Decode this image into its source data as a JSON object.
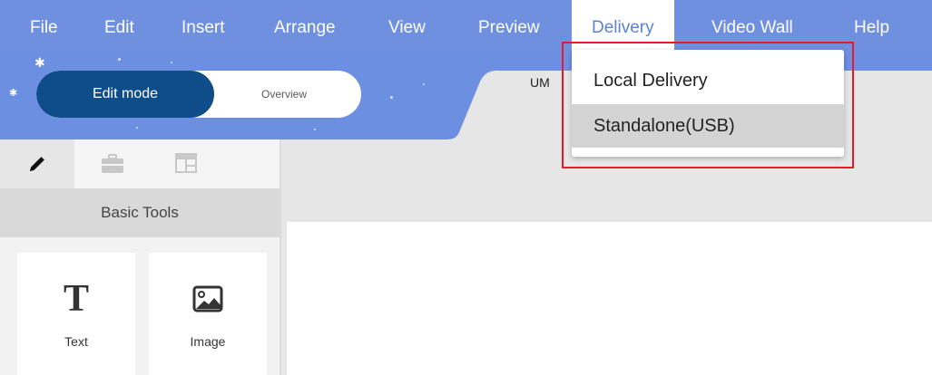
{
  "menubar": {
    "items": [
      {
        "label": "File"
      },
      {
        "label": "Edit"
      },
      {
        "label": "Insert"
      },
      {
        "label": "Arrange"
      },
      {
        "label": "View"
      },
      {
        "label": "Preview"
      },
      {
        "label": "Delivery"
      },
      {
        "label": "Video Wall"
      },
      {
        "label": "Help"
      }
    ],
    "active_item": "Delivery"
  },
  "mode_toggle": {
    "edit_label": "Edit mode",
    "overview_label": "Overview",
    "selected": "Edit mode"
  },
  "canvas": {
    "tab_label": "UM"
  },
  "left_panel": {
    "tabs": [
      {
        "icon": "pencil-icon",
        "active": true
      },
      {
        "icon": "briefcase-icon",
        "active": false
      },
      {
        "icon": "layout-icon",
        "active": false
      }
    ],
    "section_title": "Basic Tools",
    "tools": [
      {
        "glyph": "T",
        "label": "Text",
        "icon": "text-icon"
      },
      {
        "label": "Image",
        "icon": "image-icon"
      }
    ]
  },
  "delivery_menu": {
    "items": [
      {
        "label": "Local Delivery"
      },
      {
        "label": "Standalone(USB)"
      }
    ],
    "hovered_item": "Standalone(USB)"
  },
  "colors": {
    "menubar": "#6f8fdf",
    "header_band": "#6d8fe2",
    "edit_mode": "#0f4d8a",
    "highlight_box": "#e8192c",
    "active_menu_text": "#5b82d9"
  }
}
